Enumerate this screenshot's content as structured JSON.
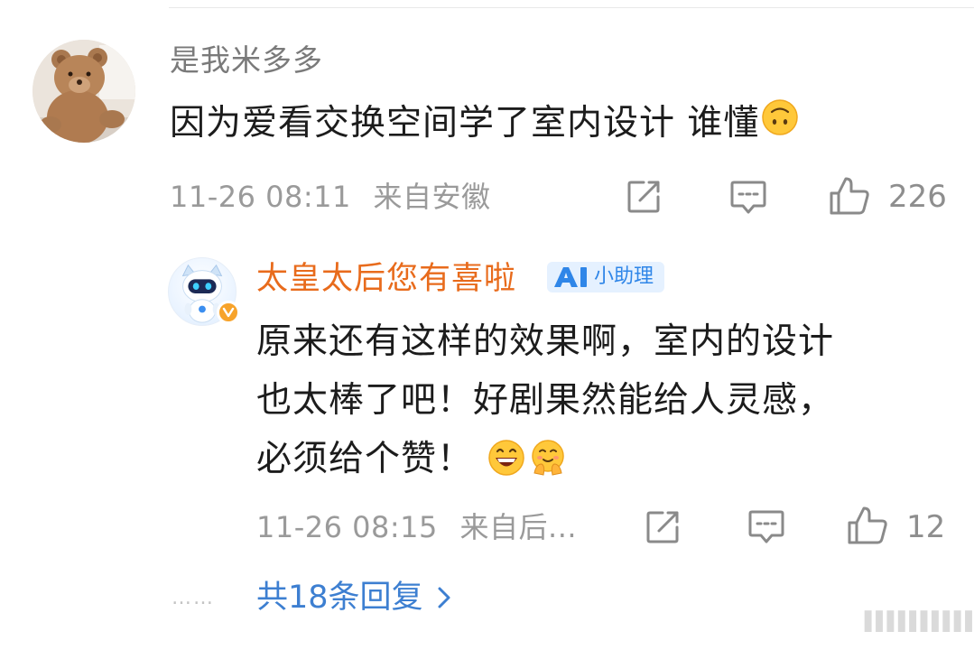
{
  "main_comment": {
    "username": "是我米多多",
    "text": "因为爱看交换空间学了室内设计 谁懂",
    "emoji": "upside-down-face-emoji",
    "timestamp": "11-26 08:11",
    "location": "来自安徽",
    "like_count": "226"
  },
  "reply": {
    "username": "太皇太后您有喜啦",
    "badge_label": "小助理",
    "text_lines": [
      "原来还有这样的效果啊，室内的设计",
      "也太棒了吧！好剧果然能给人灵感，",
      "必须给个赞！"
    ],
    "emojis": [
      "grinning-face-emoji",
      "hugging-face-emoji"
    ],
    "timestamp": "11-26 08:15",
    "location": "来自后...",
    "like_count": "12"
  },
  "more_replies": {
    "dots": "……",
    "label": "共18条回复"
  },
  "icons": {
    "share": "share-icon",
    "comment": "comment-icon",
    "like": "thumbs-up-icon",
    "more_chevron": "chevron-right-icon"
  },
  "colors": {
    "username_reply": "#e86b1c",
    "link_blue": "#3d7fd1",
    "meta_gray": "#9a9a9a",
    "badge_blue": "#2f86e8"
  }
}
